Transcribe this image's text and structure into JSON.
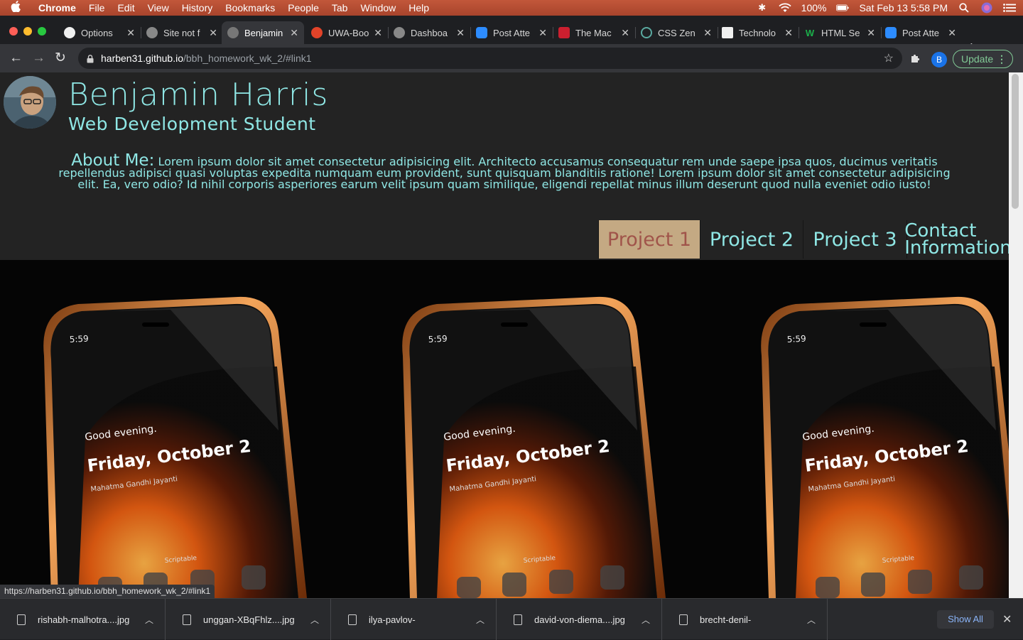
{
  "menubar": {
    "app": "Chrome",
    "items": [
      "File",
      "Edit",
      "View",
      "History",
      "Bookmarks",
      "People",
      "Tab",
      "Window",
      "Help"
    ],
    "battery": "100%",
    "datetime": "Sat Feb 13  5:58 PM"
  },
  "tabs": [
    {
      "label": "Options",
      "icon": "github-icon",
      "color": "#f0f0f0"
    },
    {
      "label": "Site not f",
      "icon": "globe-icon",
      "color": "#888888"
    },
    {
      "label": "Benjamin",
      "icon": "globe-icon",
      "color": "#777777"
    },
    {
      "label": "UWA-Boo",
      "icon": "gitlab-icon",
      "color": "#e24329"
    },
    {
      "label": "Dashboa",
      "icon": "globe-icon",
      "color": "#888888"
    },
    {
      "label": "Post Atte",
      "icon": "zoom-icon",
      "color": "#2d8cff"
    },
    {
      "label": "The Mac",
      "icon": "hub-icon",
      "color": "#cc1f2f"
    },
    {
      "label": "CSS Zen",
      "icon": "zen-icon",
      "color": "#5aa9a0"
    },
    {
      "label": "Technolo",
      "icon": "technology-icon",
      "color": "#f0f0f0"
    },
    {
      "label": "HTML Se",
      "icon": "w-icon",
      "color": "#1bb04b"
    },
    {
      "label": "Post Atte",
      "icon": "zoom-icon",
      "color": "#2d8cff"
    }
  ],
  "address": {
    "host": "harben31.github.io",
    "path": "/bbh_homework_wk_2/#link1"
  },
  "toolbar": {
    "profile_initial": "B",
    "update_label": "Update"
  },
  "page": {
    "name": "Benjamin Harris",
    "subtitle": "Web Development Student",
    "about_label": "About Me:",
    "about_text": "Lorem ipsum dolor sit amet consectetur adipisicing elit. Architecto accusamus consequatur rem unde saepe ipsa quos, ducimus veritatis repellendus adipisci quasi voluptas expedita numquam eum provident, sunt quisquam blanditiis ratione! Lorem ipsum dolor sit amet consectetur adipisicing elit. Ea, vero odio? Id nihil corporis asperiores earum velit ipsum quam similique, eligendi repellat minus illum deserunt quod nulla eveniet odio iusto!",
    "nav": [
      {
        "label": "Project 1"
      },
      {
        "label": "Project 2"
      },
      {
        "label": "Project 3"
      },
      {
        "label": "Contact Information"
      }
    ],
    "phone": {
      "time": "5:59",
      "greeting": "Good evening.",
      "date": "Friday, October 2",
      "holiday": "Mahatma Gandhi Jayanti",
      "app": "Scriptable"
    }
  },
  "status_url": "https://harben31.github.io/bbh_homework_wk_2/#link1",
  "downloads": {
    "items": [
      "rishabh-malhotra....jpg",
      "unggan-XBqFhlz....jpg",
      "ilya-pavlov-",
      "david-von-diema....jpg",
      "brecht-denil-"
    ],
    "show_all": "Show All"
  },
  "colors": {
    "accent_teal": "#8fe7e5",
    "active_nav_bg": "#c4a983",
    "active_nav_text": "#a0544a"
  }
}
